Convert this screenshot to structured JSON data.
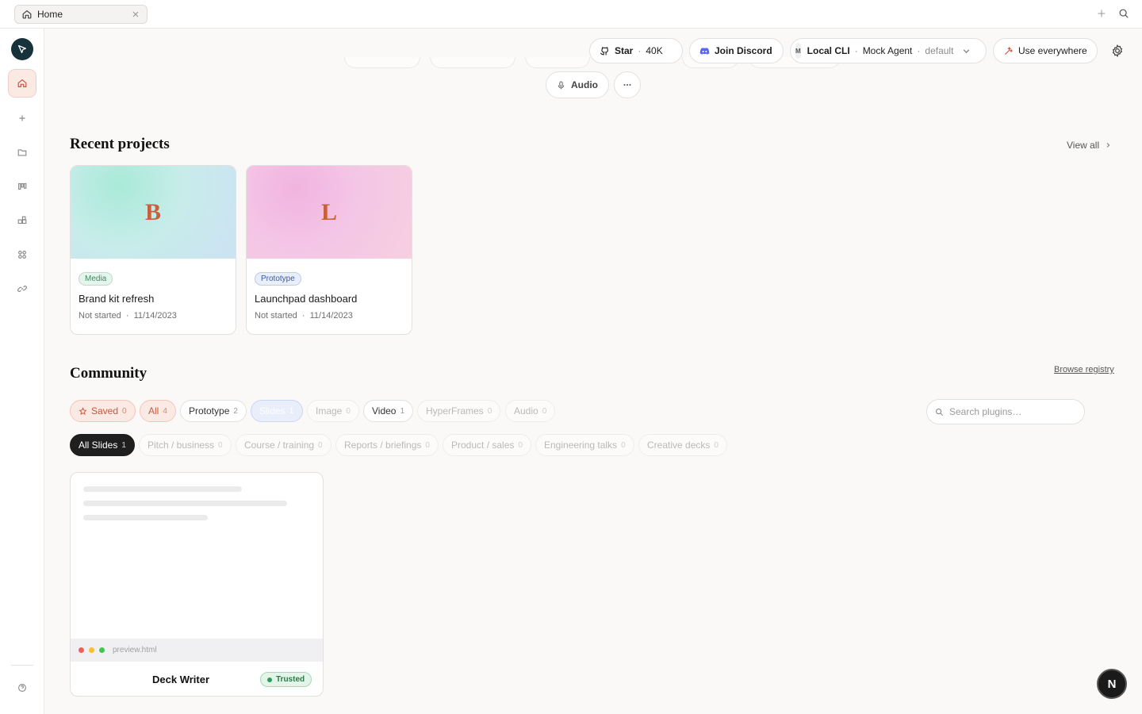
{
  "tab": {
    "label": "Home"
  },
  "header": {
    "star_label": "Star",
    "star_count": "40K",
    "discord_label": "Join Discord",
    "agent_label": "Local CLI",
    "agent_name": "Mock Agent",
    "agent_mode": "default",
    "agent_glyph": "M",
    "use_everywhere_label": "Use everywhere",
    "audio_label": "Audio"
  },
  "recent": {
    "title": "Recent projects",
    "view_all": "View all",
    "projects": [
      {
        "initial": "B",
        "tag": "Media",
        "name": "Brand kit refresh",
        "status": "Not started",
        "date": "11/14/2023"
      },
      {
        "initial": "L",
        "tag": "Prototype",
        "name": "Launchpad dashboard",
        "status": "Not started",
        "date": "11/14/2023"
      }
    ]
  },
  "community": {
    "title": "Community",
    "browse": "Browse registry",
    "search_placeholder": "Search plugins…",
    "filters": [
      {
        "label": "Saved",
        "count": "0"
      },
      {
        "label": "All",
        "count": "4"
      },
      {
        "label": "Prototype",
        "count": "2"
      },
      {
        "label": "Slides",
        "count": "1"
      },
      {
        "label": "Image",
        "count": "0"
      },
      {
        "label": "Video",
        "count": "1"
      },
      {
        "label": "HyperFrames",
        "count": "0"
      },
      {
        "label": "Audio",
        "count": "0"
      }
    ],
    "subfilters": [
      {
        "label": "All Slides",
        "count": "1"
      },
      {
        "label": "Pitch / business",
        "count": "0"
      },
      {
        "label": "Course / training",
        "count": "0"
      },
      {
        "label": "Reports / briefings",
        "count": "0"
      },
      {
        "label": "Product / sales",
        "count": "0"
      },
      {
        "label": "Engineering talks",
        "count": "0"
      },
      {
        "label": "Creative decks",
        "count": "0"
      }
    ],
    "plugin": {
      "file": "preview.html",
      "name": "Deck Writer",
      "badge": "Trusted"
    }
  },
  "fab_label": "N",
  "colors": {
    "accent": "#c45a3f",
    "logo_bg": "#17323a",
    "discord": "#5865f2"
  }
}
